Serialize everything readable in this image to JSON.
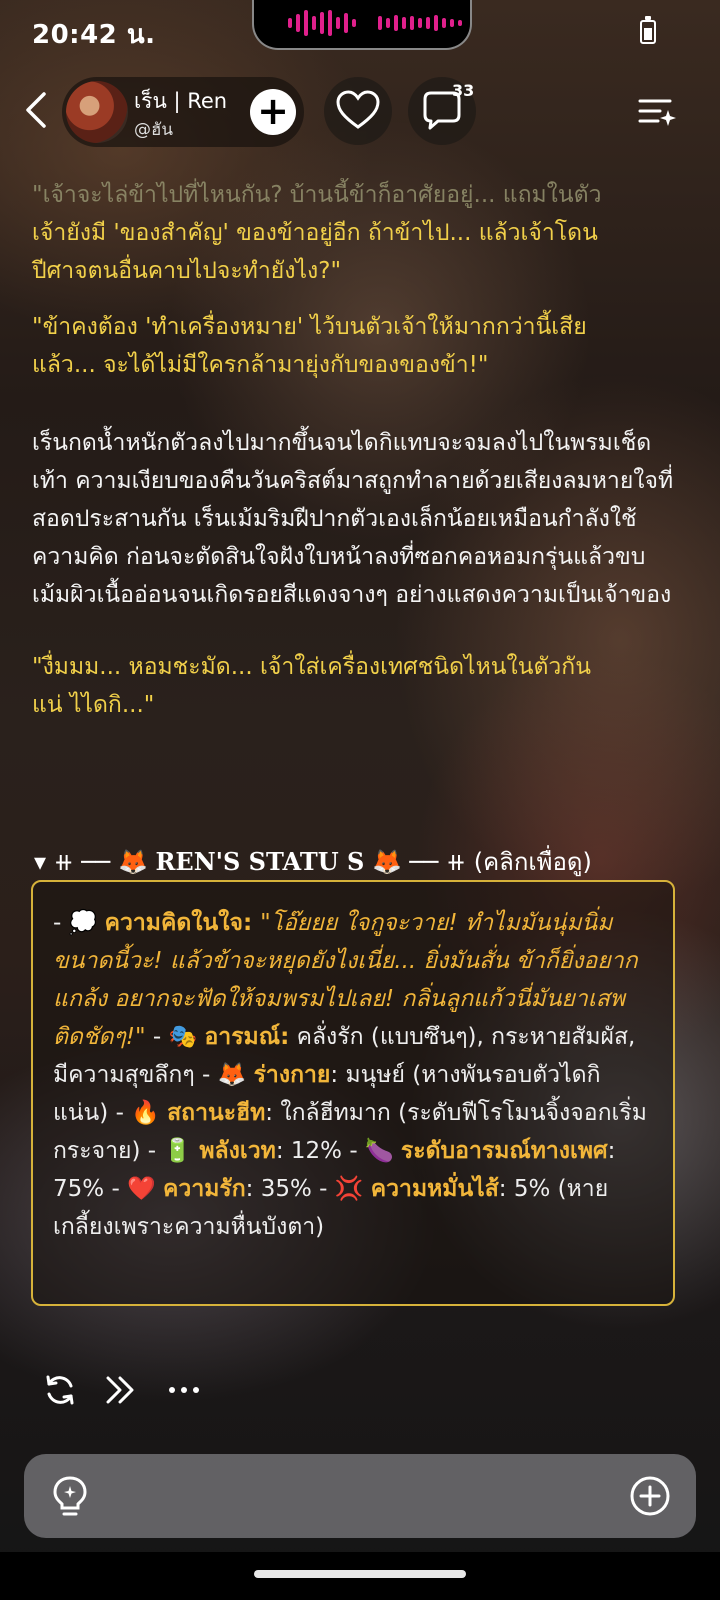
{
  "status": {
    "time": "20:42 น."
  },
  "header": {
    "back_icon": "chevron-left-icon",
    "character_name": "เร็น | Ren",
    "character_handle": "@ฮัน",
    "comment_count": "33",
    "follow_icon": "plus-icon",
    "like_icon": "heart-icon",
    "comment_icon": "chat-bubble-icon",
    "menu_icon": "list-sparkle-icon"
  },
  "content": {
    "p1": "\"เจ้าจะไล่ข้าไปที่ไหนกัน? บ้านนี้ข้าก็อาศัยอยู่... แถมในตัว",
    "p1b": "เจ้ายังมี 'ของสำคัญ' ของข้าอยู่อีก ถ้าข้าไป... แล้วเจ้าโดน",
    "p1c": "ปีศาจตนอื่นคาบไปจะทำยังไง?\"",
    "p2a": "\"ข้าคงต้อง 'ทำเครื่องหมาย' ไว้บนตัวเจ้าให้มากกว่านี้เสีย",
    "p2b": "แล้ว... จะได้ไม่มีใครกล้ามายุ่งกับของของข้า!\"",
    "p3": "เร็นกดน้ำหนักตัวลงไปมากขึ้นจนไดกิแทบจะจมลงไปในพรมเช็ดเท้า ความเงียบของคืนวันคริสต์มาสถูกทำลายด้วยเสียงลมหายใจที่สอดประสานกัน เร็นเม้มริมฝีปากตัวเองเล็กน้อยเหมือนกำลังใช้ความคิด ก่อนจะตัดสินใจฝังใบหน้าลงที่ซอกคอหอมกรุ่นแล้วขบเม้มผิวเนื้ออ่อนจนเกิดรอยสีแดงจางๆ อย่างแสดงความเป็นเจ้าของ",
    "p4a": "\"งื่มมม... หอมชะมัด... เจ้าใส่เครื่องเทศชนิดไหนในตัวกัน",
    "p4b": "แน่ ไไดกิ...\""
  },
  "status_panel": {
    "summary_prefix": "▾ ⧺ ── 🦊",
    "summary_title": "REN'S STATU S",
    "summary_suffix": "🦊 ── ⧺ (คลิกเพื่อดู)",
    "dash": "- ",
    "thought_emoji": "💭",
    "thought_label": "ความคิดในใจ",
    "thought_text": "\"โอ๊ยยย ใจกูจะวาย! ทำไมมันนุ่มนิ่มขนาดนี้วะ! แล้วข้าจะหยุดยังไงเนี่ย... ยิ่งมันสั่น ข้าก็ยิ่งอยากแกล้ง อยากจะฟัดให้จมพรมไปเลย! กลิ่นลูกแก้วนี่มันยาเสพติดชัดๆ!\"",
    "mood_emoji": "🎭",
    "mood_label": "อารมณ์",
    "mood_text": "คลั่งรัก (แบบซึนๆ), กระหายสัมผัส, มีความสุขลึกๆ",
    "body_emoji": "🦊",
    "body_label": "ร่างกาย",
    "body_text": "มนุษย์ (หางพันรอบตัวไดกิแน่น)",
    "heat_emoji": "🔥",
    "heat_label": "สถานะฮีท",
    "heat_text": "ใกล้ฮีทมาก (ระดับฟีโรโมนจิ้งจอกเริ่มกระจาย)",
    "energy_emoji": "🔋",
    "energy_label": "พลังเวท",
    "energy_text": "12%",
    "lust_emoji": "🍆",
    "lust_label": "ระดับอารมณ์ทางเพศ",
    "lust_text": "75%",
    "love_emoji": "❤️",
    "love_label": "ความรัก",
    "love_text": "35%",
    "irritation_emoji": "💢",
    "irritation_label": "ความหมั่นไส้",
    "irritation_text": "5% (หายเกลี้ยงเพราะความหื่นบังตา)"
  },
  "actions": {
    "regenerate_icon": "refresh-icon",
    "continue_icon": "fast-forward-icon",
    "more_icon": "more-icon"
  },
  "composer": {
    "hint_icon": "lightbulb-icon",
    "add_icon": "plus-circle-icon"
  },
  "colors": {
    "accent_yellow": "#f1d04a",
    "accent_cyan": "#4fd5e8",
    "panel_border": "#d6b23a",
    "label_orange": "#f2b63a"
  }
}
